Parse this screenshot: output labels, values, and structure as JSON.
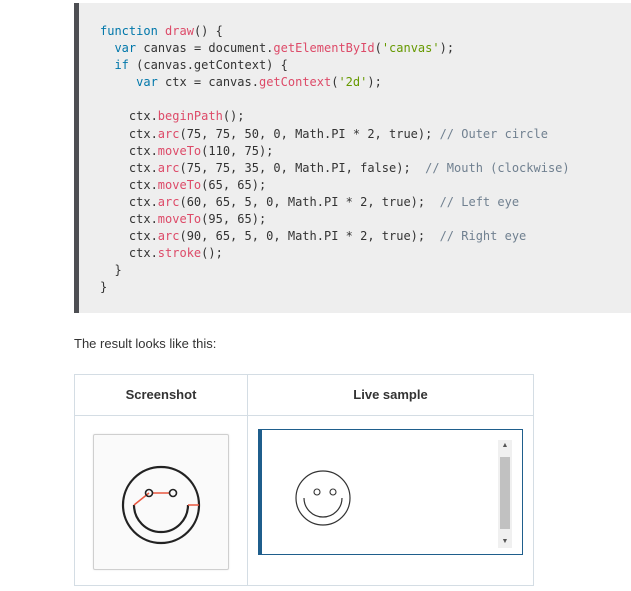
{
  "code_lines": [
    [
      {
        "t": "function",
        "c": "kw"
      },
      {
        "t": " "
      },
      {
        "t": "draw",
        "c": "fn"
      },
      {
        "t": "() {"
      }
    ],
    [
      {
        "t": "  "
      },
      {
        "t": "var",
        "c": "kw"
      },
      {
        "t": " canvas = document."
      },
      {
        "t": "getElementById",
        "c": "fn"
      },
      {
        "t": "("
      },
      {
        "t": "'canvas'",
        "c": "str"
      },
      {
        "t": ");"
      }
    ],
    [
      {
        "t": "  "
      },
      {
        "t": "if",
        "c": "kw"
      },
      {
        "t": " (canvas.getContext) {"
      }
    ],
    [
      {
        "t": "     "
      },
      {
        "t": "var",
        "c": "kw"
      },
      {
        "t": " ctx = canvas."
      },
      {
        "t": "getContext",
        "c": "fn"
      },
      {
        "t": "("
      },
      {
        "t": "'2d'",
        "c": "str"
      },
      {
        "t": ");"
      }
    ],
    [],
    [
      {
        "t": "    ctx."
      },
      {
        "t": "beginPath",
        "c": "fn"
      },
      {
        "t": "();"
      }
    ],
    [
      {
        "t": "    ctx."
      },
      {
        "t": "arc",
        "c": "fn"
      },
      {
        "t": "(75, 75, 50, 0, Math.PI * 2, true); "
      },
      {
        "t": "// Outer circle",
        "c": "cm"
      }
    ],
    [
      {
        "t": "    ctx."
      },
      {
        "t": "moveTo",
        "c": "fn"
      },
      {
        "t": "(110, 75);"
      }
    ],
    [
      {
        "t": "    ctx."
      },
      {
        "t": "arc",
        "c": "fn"
      },
      {
        "t": "(75, 75, 35, 0, Math.PI, false);  "
      },
      {
        "t": "// Mouth (clockwise)",
        "c": "cm"
      }
    ],
    [
      {
        "t": "    ctx."
      },
      {
        "t": "moveTo",
        "c": "fn"
      },
      {
        "t": "(65, 65);"
      }
    ],
    [
      {
        "t": "    ctx."
      },
      {
        "t": "arc",
        "c": "fn"
      },
      {
        "t": "(60, 65, 5, 0, Math.PI * 2, true);  "
      },
      {
        "t": "// Left eye",
        "c": "cm"
      }
    ],
    [
      {
        "t": "    ctx."
      },
      {
        "t": "moveTo",
        "c": "fn"
      },
      {
        "t": "(95, 65);"
      }
    ],
    [
      {
        "t": "    ctx."
      },
      {
        "t": "arc",
        "c": "fn"
      },
      {
        "t": "(90, 65, 5, 0, Math.PI * 2, true);  "
      },
      {
        "t": "// Right eye",
        "c": "cm"
      }
    ],
    [
      {
        "t": "    ctx."
      },
      {
        "t": "stroke",
        "c": "fn"
      },
      {
        "t": "();"
      }
    ],
    [
      {
        "t": "  }"
      }
    ],
    [
      {
        "t": "}"
      }
    ]
  ],
  "result_text": "The result looks like this:",
  "table": {
    "col_screenshot": "Screenshot",
    "col_live": "Live sample"
  },
  "scrollbar": {
    "up_arrow": "▲",
    "down_arrow": "▼"
  },
  "colors": {
    "code_bg": "#eeeeee",
    "code_border": "#4d4e53",
    "live_frame_border": "#1f5e8c",
    "path_highlight": "#e9573f"
  }
}
